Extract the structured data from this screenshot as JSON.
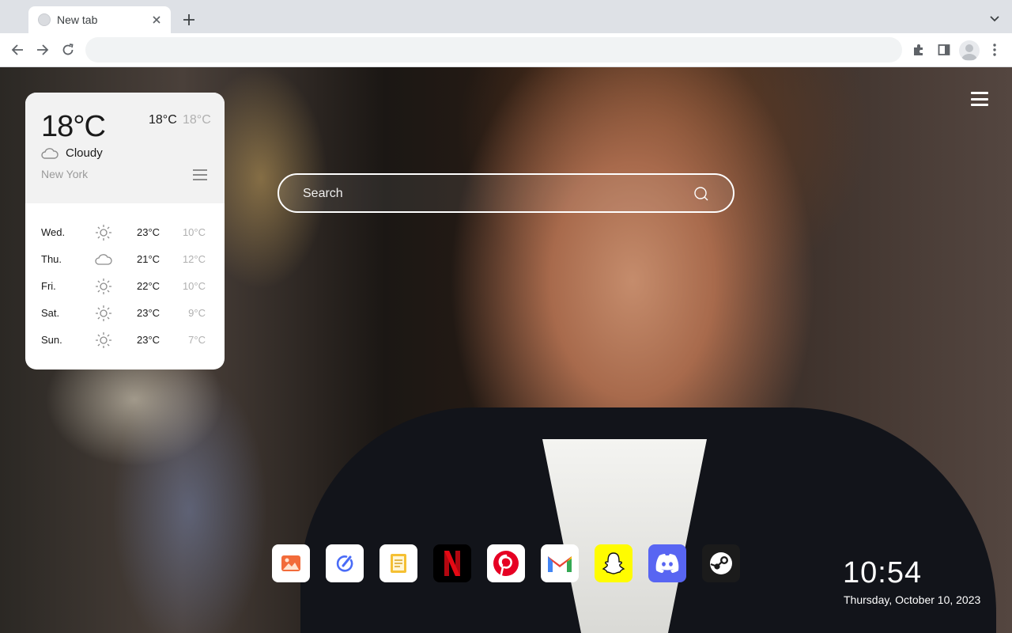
{
  "browser": {
    "tab": {
      "title": "New tab",
      "close_icon": "close-icon",
      "favicon": "default-globe-icon"
    },
    "new_tab_icon": "plus-icon",
    "tab_search_icon": "chevron-down-icon",
    "nav": {
      "back_icon": "back-arrow-icon",
      "forward_icon": "forward-arrow-icon",
      "reload_icon": "reload-icon"
    },
    "omnibox": {
      "value": "",
      "placeholder": ""
    },
    "toolbar_icons": [
      "extensions-puzzle-icon",
      "side-panel-icon",
      "profile-avatar",
      "kebab-menu-icon"
    ]
  },
  "page": {
    "menu_icon": "hamburger-menu-icon",
    "weather": {
      "current_temp": "18°C",
      "high": "18°C",
      "low": "18°C",
      "condition": "Cloudy",
      "condition_icon": "cloud-icon",
      "city": "New York",
      "list_icon": "list-icon",
      "forecast": [
        {
          "day": "Wed.",
          "icon": "sun-icon",
          "high": "23°C",
          "low": "10°C"
        },
        {
          "day": "Thu.",
          "icon": "cloud-icon",
          "high": "21°C",
          "low": "12°C"
        },
        {
          "day": "Fri.",
          "icon": "sun-icon",
          "high": "22°C",
          "low": "10°C"
        },
        {
          "day": "Sat.",
          "icon": "sun-icon",
          "high": "23°C",
          "low": "9°C"
        },
        {
          "day": "Sun.",
          "icon": "sun-icon",
          "high": "23°C",
          "low": "7°C"
        }
      ]
    },
    "search": {
      "placeholder": "Search",
      "icon": "search-icon"
    },
    "shortcuts": [
      {
        "name": "photos",
        "icon": "photo-gallery-icon",
        "bg": "#ffffff",
        "accent": "#f26b3a"
      },
      {
        "name": "tasks",
        "icon": "check-pen-icon",
        "bg": "#ffffff",
        "accent": "#4a6cf7"
      },
      {
        "name": "notes",
        "icon": "notes-icon",
        "bg": "#ffffff",
        "accent": "#f5c033"
      },
      {
        "name": "netflix",
        "icon": "netflix-logo-icon",
        "bg": "#000000",
        "accent": "#e50914"
      },
      {
        "name": "pinterest",
        "icon": "pinterest-logo-icon",
        "bg": "#ffffff",
        "accent": "#e60023"
      },
      {
        "name": "gmail",
        "icon": "gmail-logo-icon",
        "bg": "#ffffff",
        "accent": "#ea4335"
      },
      {
        "name": "snapchat",
        "icon": "snapchat-ghost-icon",
        "bg": "#fffc00",
        "accent": "#ffffff"
      },
      {
        "name": "discord",
        "icon": "discord-logo-icon",
        "bg": "#5865f2",
        "accent": "#ffffff"
      },
      {
        "name": "steam",
        "icon": "steam-logo-icon",
        "bg": "#1b1b1b",
        "accent": "#ffffff"
      }
    ],
    "clock": {
      "time": "10:54",
      "date": "Thursday, October 10, 2023"
    }
  }
}
